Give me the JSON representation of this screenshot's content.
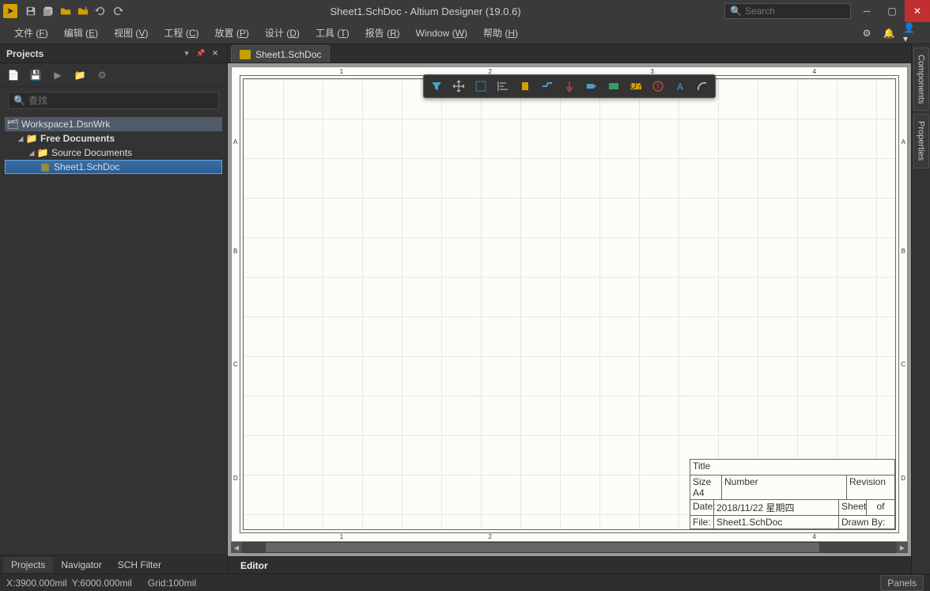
{
  "titlebar": {
    "title": "Sheet1.SchDoc - Altium Designer (19.0.6)",
    "search_placeholder": "Search"
  },
  "menubar": {
    "items": [
      {
        "label": "文件",
        "accel": "F"
      },
      {
        "label": "编辑",
        "accel": "E"
      },
      {
        "label": "视图",
        "accel": "V"
      },
      {
        "label": "工程",
        "accel": "C"
      },
      {
        "label": "放置",
        "accel": "P"
      },
      {
        "label": "设计",
        "accel": "D"
      },
      {
        "label": "工具",
        "accel": "T"
      },
      {
        "label": "报告",
        "accel": "R"
      },
      {
        "label": "Window",
        "accel": "W"
      },
      {
        "label": "帮助",
        "accel": "H"
      }
    ]
  },
  "projects_panel": {
    "title": "Projects",
    "search_placeholder": "查找",
    "tree": {
      "workspace": "Workspace1.DsnWrk",
      "free_documents": "Free Documents",
      "source_documents": "Source Documents",
      "sheet": "Sheet1.SchDoc"
    },
    "bottom_tabs": [
      "Projects",
      "Navigator",
      "SCH Filter"
    ]
  },
  "doc_tab": {
    "label": "Sheet1.SchDoc"
  },
  "editor_tab": "Editor",
  "right_tabs": [
    "Components",
    "Properties"
  ],
  "sheet": {
    "col_refs": [
      "1",
      "2",
      "3",
      "4"
    ],
    "row_refs": [
      "A",
      "B",
      "C",
      "D"
    ],
    "titleblock": {
      "title_label": "Title",
      "size_label": "Size",
      "size_value": "A4",
      "number_label": "Number",
      "revision_label": "Revision",
      "date_label": "Date:",
      "date_value": "2018/11/22 星期四",
      "sheet_label": "Sheet",
      "of_label": "of",
      "file_label": "File:",
      "file_value": "Sheet1.SchDoc",
      "drawn_label": "Drawn By:"
    }
  },
  "statusbar": {
    "coords_x": "X:3900.000mil",
    "coords_y": "Y:6000.000mil",
    "grid": "Grid:100mil",
    "panels": "Panels"
  },
  "float_toolbar_icons": [
    "filter",
    "move",
    "select-rect",
    "align",
    "component",
    "net",
    "power",
    "port",
    "bus",
    "designator",
    "chevron-left",
    "text",
    "arc"
  ]
}
